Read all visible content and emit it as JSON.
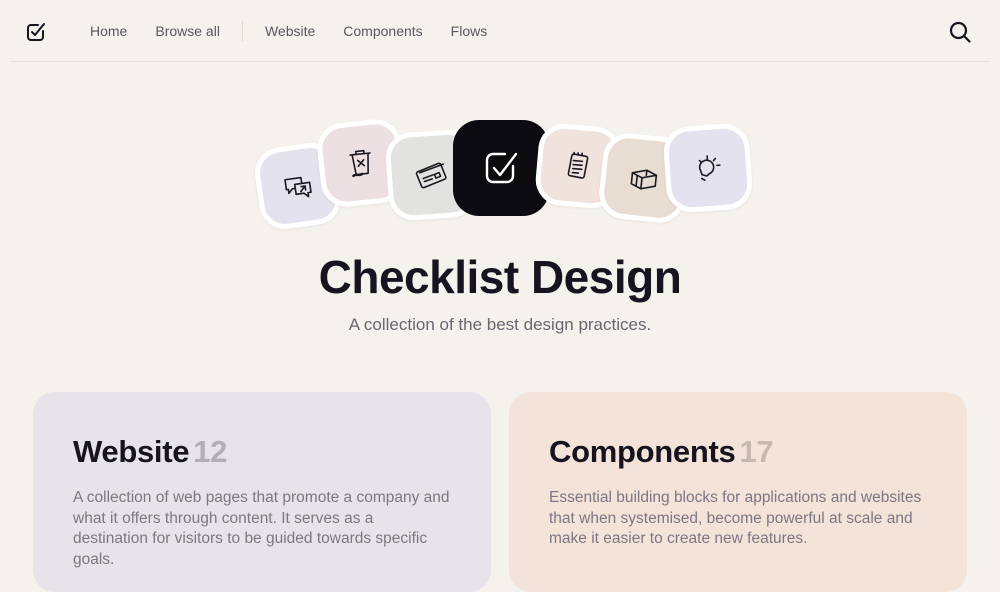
{
  "nav": {
    "links": [
      "Home",
      "Browse all"
    ],
    "links2": [
      "Website",
      "Components",
      "Flows"
    ]
  },
  "icons": [
    "chat-share-icon",
    "trash-x-icon",
    "card-icon",
    "checkbox-icon",
    "notepad-icon",
    "box-icon",
    "lightbulb-icon"
  ],
  "colors": {
    "background": "#f5f2ee",
    "website_card": "#e7e3ea",
    "components_card": "#f3e3d9",
    "tile_lavender": "#e4e2ef",
    "tile_pink": "#ece0e3",
    "tile_gray": "#e2e3e1",
    "tile_peach": "#f0e3dd",
    "tile_beige": "#e7ddd2",
    "tile_main": "#0c0b10"
  },
  "hero": {
    "title": "Checklist Design",
    "subtitle": "A collection of the best design practices."
  },
  "cards": [
    {
      "title": "Website",
      "count": "12",
      "description": "A collection of web pages that promote a company and what it offers through content. It serves as a destination for visitors to be guided towards specific goals."
    },
    {
      "title": "Components",
      "count": "17",
      "description": "Essential building blocks for applications and websites that when systemised, become powerful at scale and make it easier to create new features."
    }
  ]
}
